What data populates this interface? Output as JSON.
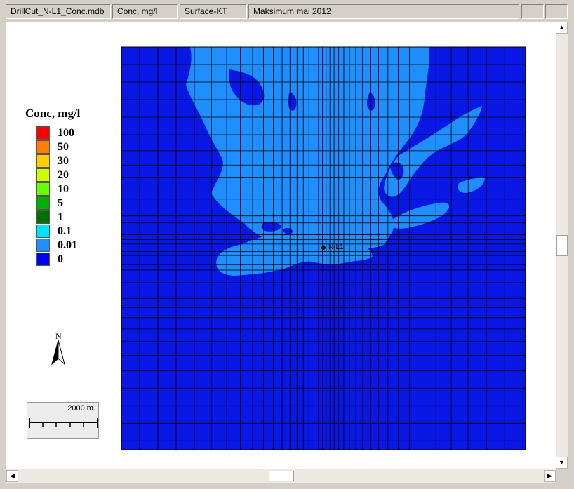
{
  "tabs": [
    {
      "label": "DrillCut_N-L1_Conc.mdb"
    },
    {
      "label": "Conc, mg/l"
    },
    {
      "label": "Surface-KT"
    },
    {
      "label": "Maksimum mai 2012"
    }
  ],
  "legend": {
    "title": "Conc, mg/l",
    "items": [
      {
        "label": "100",
        "color": "#ff0000"
      },
      {
        "label": "50",
        "color": "#ff7f00"
      },
      {
        "label": "30",
        "color": "#ffcc00"
      },
      {
        "label": "20",
        "color": "#ccff00"
      },
      {
        "label": "10",
        "color": "#66ff00"
      },
      {
        "label": "5",
        "color": "#00b000"
      },
      {
        "label": "1",
        "color": "#007000"
      },
      {
        "label": "0.1",
        "color": "#00e0ff"
      },
      {
        "label": "0.01",
        "color": "#1f8fff"
      },
      {
        "label": "0",
        "color": "#0000ff"
      }
    ]
  },
  "map": {
    "background_color": "#0a18e6",
    "plume_color": "#1f8fff",
    "site_label": "N-L1"
  },
  "north_arrow": {
    "label": "N"
  },
  "scale_bar": {
    "label": "2000 m."
  },
  "scrollbars": {
    "vertical_position": 0.5,
    "horizontal_position": 0.5
  }
}
